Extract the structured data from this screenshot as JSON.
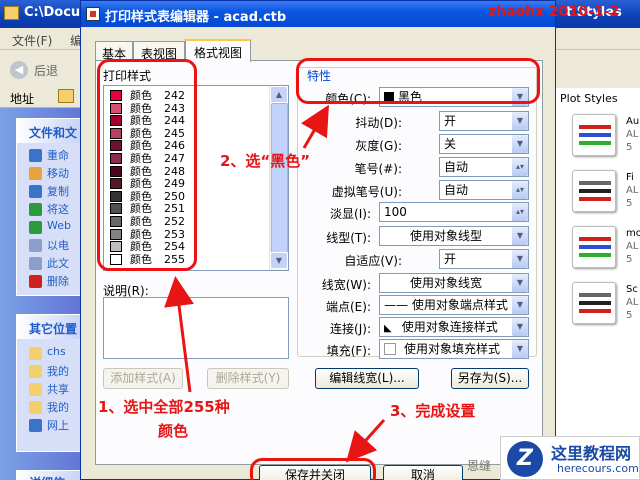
{
  "background": {
    "title": "C:\\Docu",
    "title_tail": "t Styles",
    "menu": [
      "文件(F)",
      "编"
    ],
    "back_label": "后退",
    "address_label": "地址",
    "plot_styles_label": "Plot Styles",
    "tasks_head": "文件和文",
    "tasks": [
      "重命",
      "移动",
      "复制",
      "将这",
      "Web",
      "以电",
      "此文",
      "删除"
    ],
    "places_head": "其它位置",
    "places": [
      "chs",
      "我的",
      "共享",
      "我的",
      "网上"
    ],
    "details_head": "详细信",
    "files": [
      {
        "name": "Au",
        "sub": "AL",
        "num": "5"
      },
      {
        "name": "Fi",
        "sub": "AL",
        "num": "5"
      },
      {
        "name": "mo",
        "sub": "AL",
        "num": "5"
      },
      {
        "name": "Sc",
        "sub": "AL",
        "num": "5"
      }
    ]
  },
  "dialog": {
    "title": "打印样式表编辑器 - acad.ctb",
    "tabs": [
      "基本",
      "表视图",
      "格式视图"
    ],
    "active_tab": 2,
    "print_styles_label": "打印样式",
    "styles": [
      {
        "label": "颜色",
        "num": "242",
        "color": "#e8003c"
      },
      {
        "label": "颜色",
        "num": "243",
        "color": "#d0506e"
      },
      {
        "label": "颜色",
        "num": "244",
        "color": "#a00030"
      },
      {
        "label": "颜色",
        "num": "245",
        "color": "#b84060"
      },
      {
        "label": "颜色",
        "num": "246",
        "color": "#701030"
      },
      {
        "label": "颜色",
        "num": "247",
        "color": "#883048"
      },
      {
        "label": "颜色",
        "num": "248",
        "color": "#4c0820"
      },
      {
        "label": "颜色",
        "num": "249",
        "color": "#581828"
      },
      {
        "label": "颜色",
        "num": "250",
        "color": "#333333"
      },
      {
        "label": "颜色",
        "num": "251",
        "color": "#505050"
      },
      {
        "label": "颜色",
        "num": "252",
        "color": "#696969"
      },
      {
        "label": "颜色",
        "num": "253",
        "color": "#828282"
      },
      {
        "label": "颜色",
        "num": "254",
        "color": "#bebebe"
      },
      {
        "label": "颜色",
        "num": "255",
        "color": "#ffffff"
      }
    ],
    "desc_label": "说明(R):",
    "add_style_btn": "添加样式(A)",
    "delete_style_btn": "删除样式(Y)",
    "properties_label": "特性",
    "props": {
      "color": {
        "label": "颜色(C):",
        "value": "黑色"
      },
      "dither": {
        "label": "抖动(D):",
        "value": "开"
      },
      "grayscale": {
        "label": "灰度(G):",
        "value": "关"
      },
      "pen": {
        "label": "笔号(#):",
        "value": "自动"
      },
      "virtual_pen": {
        "label": "虚拟笔号(U):",
        "value": "自动"
      },
      "screening": {
        "label": "淡显(I):",
        "value": "100"
      },
      "linetype": {
        "label": "线型(T):",
        "value": "使用对象线型"
      },
      "adaptive": {
        "label": "自适应(V):",
        "value": "开"
      },
      "lineweight": {
        "label": "线宽(W):",
        "value": "使用对象线宽"
      },
      "endstyle": {
        "label": "端点(E):",
        "value": "—— 使用对象端点样式"
      },
      "joinstyle": {
        "label": "连接(J):",
        "value": "使用对象连接样式"
      },
      "fill": {
        "label": "填充(F):",
        "value": "使用对象填充样式"
      }
    },
    "edit_lineweight_btn": "编辑线宽(L)...",
    "save_as_btn": "另存为(S)...",
    "save_close_btn": "保存并关闭",
    "cancel_btn": "取消",
    "detail_label": "恩缝"
  },
  "annotations": {
    "step1": "1、选中全部255种",
    "step1b": "颜色",
    "step2": "2、选“黑色”",
    "step3": "3、完成设置"
  },
  "watermark": "zhaohx 2010-1-2",
  "logo": {
    "name": "这里教程网",
    "url": "herecours.com"
  },
  "colors": {
    "annotation": "#e81515",
    "xp_blue": "#0548d4"
  }
}
